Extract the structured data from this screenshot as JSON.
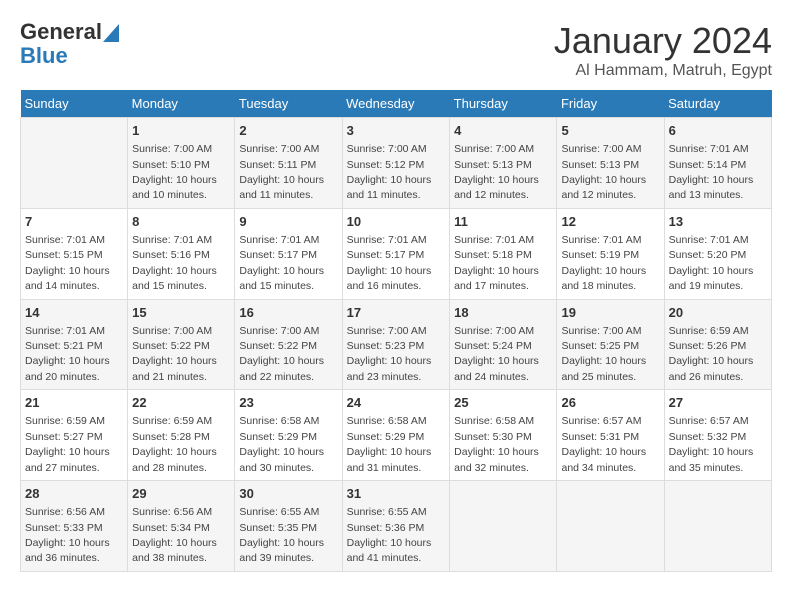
{
  "header": {
    "logo_line1": "General",
    "logo_line2": "Blue",
    "month_title": "January 2024",
    "location": "Al Hammam, Matruh, Egypt"
  },
  "days_of_week": [
    "Sunday",
    "Monday",
    "Tuesday",
    "Wednesday",
    "Thursday",
    "Friday",
    "Saturday"
  ],
  "weeks": [
    [
      {
        "day": "",
        "info": ""
      },
      {
        "day": "1",
        "info": "Sunrise: 7:00 AM\nSunset: 5:10 PM\nDaylight: 10 hours\nand 10 minutes."
      },
      {
        "day": "2",
        "info": "Sunrise: 7:00 AM\nSunset: 5:11 PM\nDaylight: 10 hours\nand 11 minutes."
      },
      {
        "day": "3",
        "info": "Sunrise: 7:00 AM\nSunset: 5:12 PM\nDaylight: 10 hours\nand 11 minutes."
      },
      {
        "day": "4",
        "info": "Sunrise: 7:00 AM\nSunset: 5:13 PM\nDaylight: 10 hours\nand 12 minutes."
      },
      {
        "day": "5",
        "info": "Sunrise: 7:00 AM\nSunset: 5:13 PM\nDaylight: 10 hours\nand 12 minutes."
      },
      {
        "day": "6",
        "info": "Sunrise: 7:01 AM\nSunset: 5:14 PM\nDaylight: 10 hours\nand 13 minutes."
      }
    ],
    [
      {
        "day": "7",
        "info": "Sunrise: 7:01 AM\nSunset: 5:15 PM\nDaylight: 10 hours\nand 14 minutes."
      },
      {
        "day": "8",
        "info": "Sunrise: 7:01 AM\nSunset: 5:16 PM\nDaylight: 10 hours\nand 15 minutes."
      },
      {
        "day": "9",
        "info": "Sunrise: 7:01 AM\nSunset: 5:17 PM\nDaylight: 10 hours\nand 15 minutes."
      },
      {
        "day": "10",
        "info": "Sunrise: 7:01 AM\nSunset: 5:17 PM\nDaylight: 10 hours\nand 16 minutes."
      },
      {
        "day": "11",
        "info": "Sunrise: 7:01 AM\nSunset: 5:18 PM\nDaylight: 10 hours\nand 17 minutes."
      },
      {
        "day": "12",
        "info": "Sunrise: 7:01 AM\nSunset: 5:19 PM\nDaylight: 10 hours\nand 18 minutes."
      },
      {
        "day": "13",
        "info": "Sunrise: 7:01 AM\nSunset: 5:20 PM\nDaylight: 10 hours\nand 19 minutes."
      }
    ],
    [
      {
        "day": "14",
        "info": "Sunrise: 7:01 AM\nSunset: 5:21 PM\nDaylight: 10 hours\nand 20 minutes."
      },
      {
        "day": "15",
        "info": "Sunrise: 7:00 AM\nSunset: 5:22 PM\nDaylight: 10 hours\nand 21 minutes."
      },
      {
        "day": "16",
        "info": "Sunrise: 7:00 AM\nSunset: 5:22 PM\nDaylight: 10 hours\nand 22 minutes."
      },
      {
        "day": "17",
        "info": "Sunrise: 7:00 AM\nSunset: 5:23 PM\nDaylight: 10 hours\nand 23 minutes."
      },
      {
        "day": "18",
        "info": "Sunrise: 7:00 AM\nSunset: 5:24 PM\nDaylight: 10 hours\nand 24 minutes."
      },
      {
        "day": "19",
        "info": "Sunrise: 7:00 AM\nSunset: 5:25 PM\nDaylight: 10 hours\nand 25 minutes."
      },
      {
        "day": "20",
        "info": "Sunrise: 6:59 AM\nSunset: 5:26 PM\nDaylight: 10 hours\nand 26 minutes."
      }
    ],
    [
      {
        "day": "21",
        "info": "Sunrise: 6:59 AM\nSunset: 5:27 PM\nDaylight: 10 hours\nand 27 minutes."
      },
      {
        "day": "22",
        "info": "Sunrise: 6:59 AM\nSunset: 5:28 PM\nDaylight: 10 hours\nand 28 minutes."
      },
      {
        "day": "23",
        "info": "Sunrise: 6:58 AM\nSunset: 5:29 PM\nDaylight: 10 hours\nand 30 minutes."
      },
      {
        "day": "24",
        "info": "Sunrise: 6:58 AM\nSunset: 5:29 PM\nDaylight: 10 hours\nand 31 minutes."
      },
      {
        "day": "25",
        "info": "Sunrise: 6:58 AM\nSunset: 5:30 PM\nDaylight: 10 hours\nand 32 minutes."
      },
      {
        "day": "26",
        "info": "Sunrise: 6:57 AM\nSunset: 5:31 PM\nDaylight: 10 hours\nand 34 minutes."
      },
      {
        "day": "27",
        "info": "Sunrise: 6:57 AM\nSunset: 5:32 PM\nDaylight: 10 hours\nand 35 minutes."
      }
    ],
    [
      {
        "day": "28",
        "info": "Sunrise: 6:56 AM\nSunset: 5:33 PM\nDaylight: 10 hours\nand 36 minutes."
      },
      {
        "day": "29",
        "info": "Sunrise: 6:56 AM\nSunset: 5:34 PM\nDaylight: 10 hours\nand 38 minutes."
      },
      {
        "day": "30",
        "info": "Sunrise: 6:55 AM\nSunset: 5:35 PM\nDaylight: 10 hours\nand 39 minutes."
      },
      {
        "day": "31",
        "info": "Sunrise: 6:55 AM\nSunset: 5:36 PM\nDaylight: 10 hours\nand 41 minutes."
      },
      {
        "day": "",
        "info": ""
      },
      {
        "day": "",
        "info": ""
      },
      {
        "day": "",
        "info": ""
      }
    ]
  ]
}
